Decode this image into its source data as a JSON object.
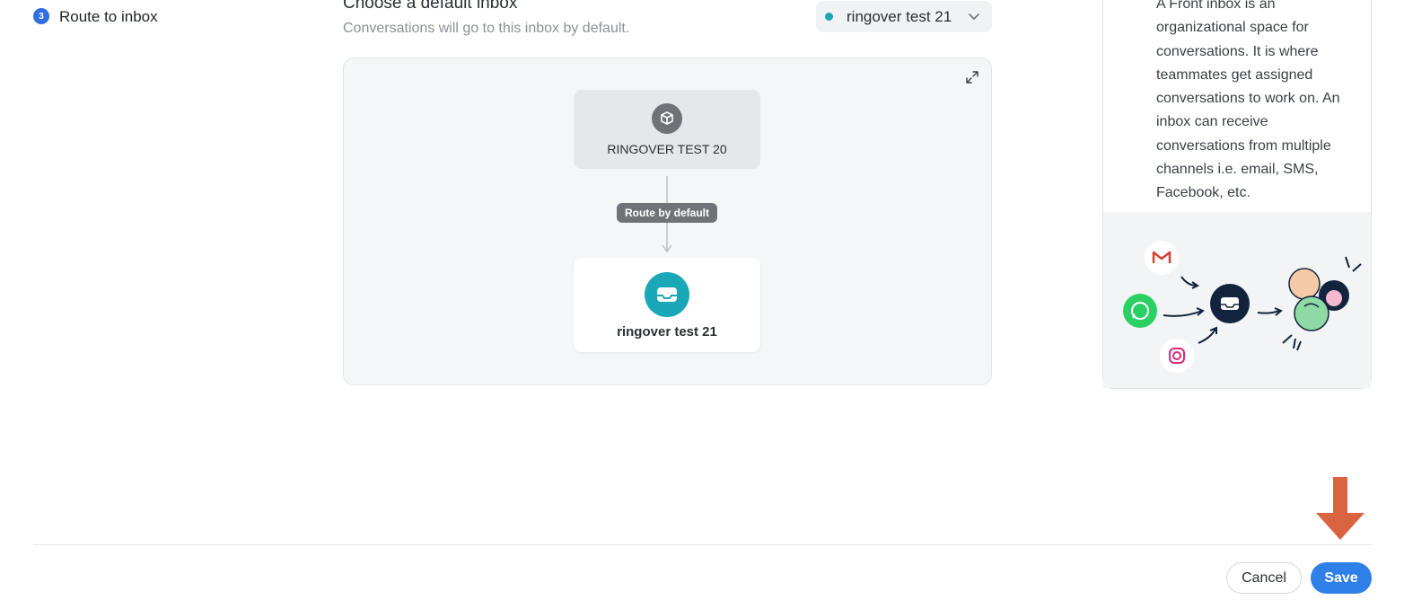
{
  "stepper": {
    "step_number": "3",
    "step_label": "Route to inbox"
  },
  "section": {
    "title": "Choose a default inbox",
    "subtitle": "Conversations will go to this inbox by default."
  },
  "inbox_select": {
    "value": "ringover test 21",
    "status_color": "#18a6b5"
  },
  "flow": {
    "source_label": "RINGOVER TEST 20",
    "route_label": "Route by default",
    "destination_label": "ringover test 21",
    "source_icon": "package-icon",
    "destination_icon": "inbox-icon"
  },
  "help": {
    "text": "A Front inbox is an organizational space for conversations. It is where teammates get assigned conversations to work on. An inbox can receive conversations from multiple channels i.e. email, SMS, Facebook, etc.",
    "channels": [
      "gmail-icon",
      "whatsapp-icon",
      "instagram-icon"
    ]
  },
  "footer": {
    "cancel_label": "Cancel",
    "save_label": "Save"
  },
  "colors": {
    "accent": "#2f7fe8",
    "inbox_teal": "#1aa7b8",
    "annotation_arrow": "#d9643f"
  }
}
